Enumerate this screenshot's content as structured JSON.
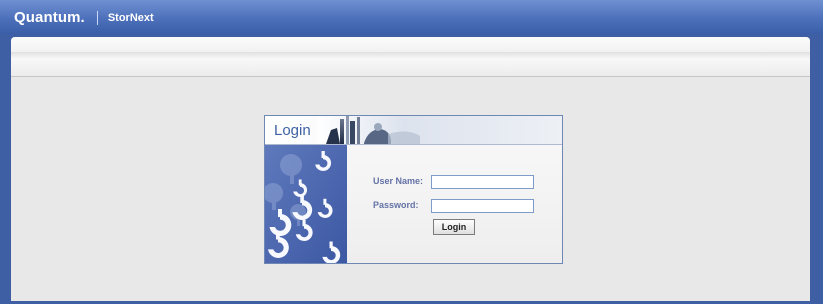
{
  "header": {
    "brand": "Quantum.",
    "product": "StorNext"
  },
  "login": {
    "title": "Login",
    "username_label": "User Name:",
    "password_label": "Password:",
    "username_value": "",
    "password_value": "",
    "submit_label": "Login"
  },
  "colors": {
    "accent": "#3f5fa5",
    "header": "#4d70bb",
    "label": "#6472a6"
  },
  "icons": {
    "logo_mark": "quantum-mark-icon",
    "decor": "keyhole-pattern-icon"
  }
}
